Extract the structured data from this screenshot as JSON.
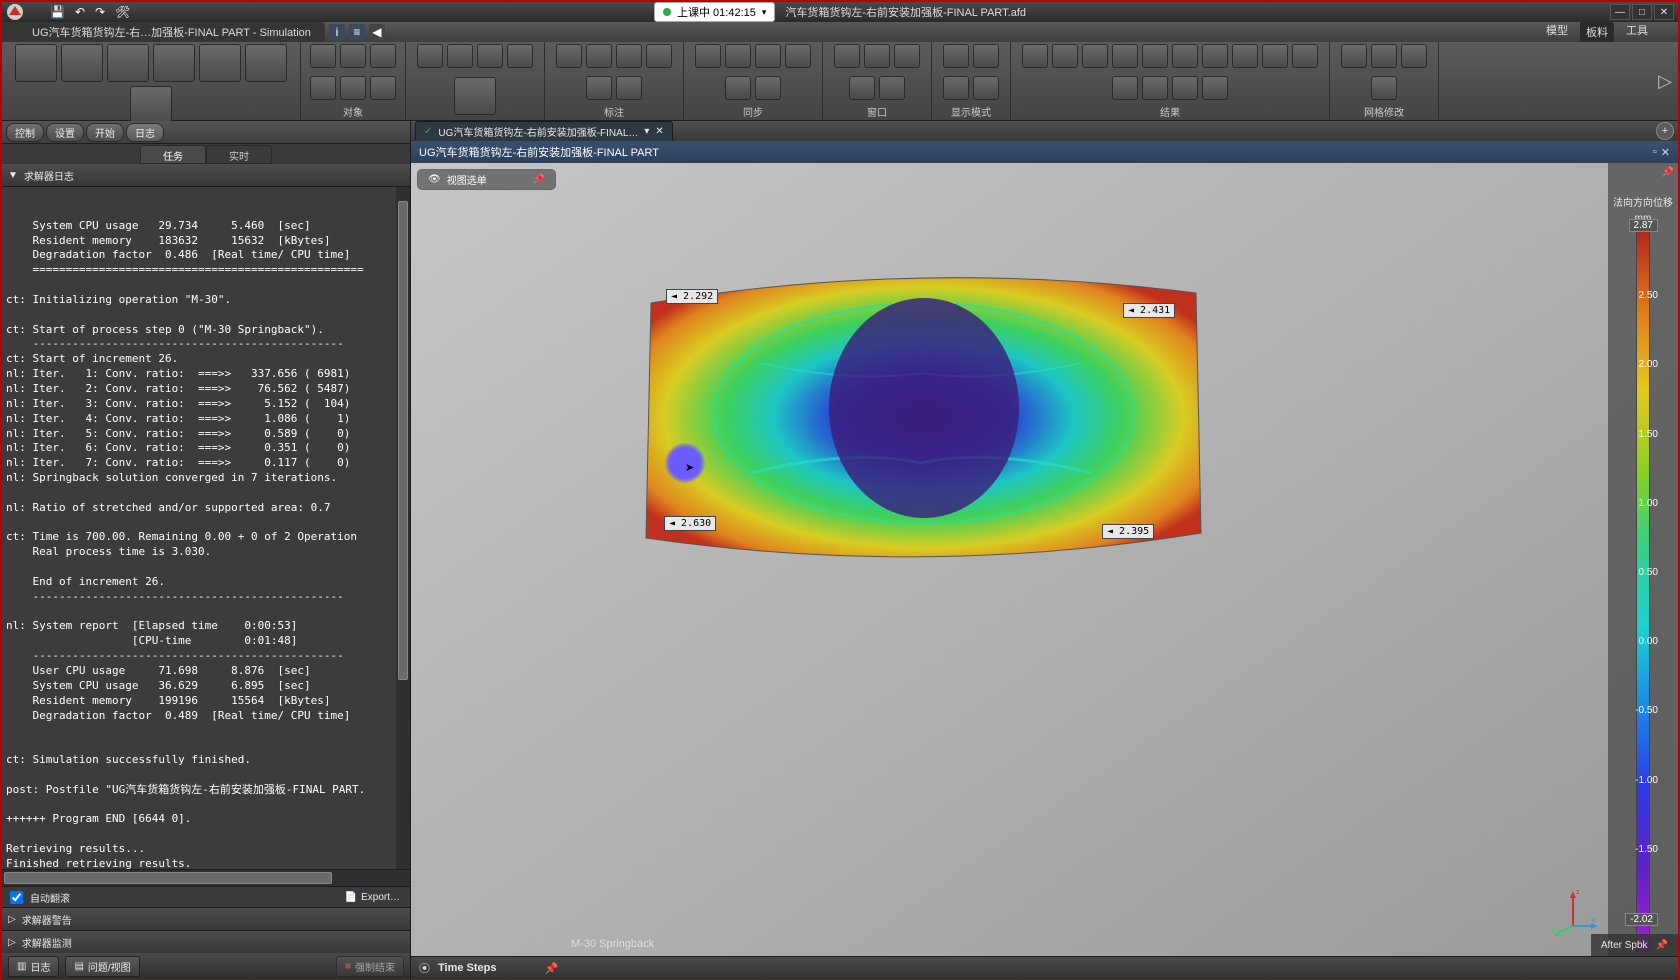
{
  "titlebar": {
    "session": "上课中 01:42:15",
    "filename": "汽车货箱货钩左-右前安装加强板-FINAL PART.afd"
  },
  "subtab": "UG汽车货箱货钩左-右…加强板-FINAL PART - Simulation",
  "menu_right": {
    "a": "模型",
    "b": "板料",
    "c": "工具"
  },
  "ribbon_groups": [
    "对象",
    "标注",
    "同步",
    "窗口",
    "显示模式",
    "结果",
    "网格修改"
  ],
  "leftpane": {
    "tabs": {
      "a": "控制",
      "b": "设置",
      "c": "开始",
      "d": "日志"
    },
    "subtabs": {
      "a": "任务",
      "b": "实时"
    },
    "header": "求解器日志",
    "autoscroll": "自动翻滚",
    "export": "Export…",
    "acc1": "求解器警告",
    "acc2": "求解器监测",
    "status1": "日志",
    "status2": "问题/视图",
    "force": "强制结束"
  },
  "log": "    System CPU usage   29.734     5.460  [sec]\n    Resident memory    183632     15632  [kBytes]\n    Degradation factor  0.486  [Real time/ CPU time]\n    ==================================================\n\nct: Initializing operation \"M-30\".\n\nct: Start of process step 0 (\"M-30 Springback\").\n    -----------------------------------------------\nct: Start of increment 26.\nnl: Iter.   1: Conv. ratio:  ===>>   337.656 ( 6981)\nnl: Iter.   2: Conv. ratio:  ===>>    76.562 ( 5487)\nnl: Iter.   3: Conv. ratio:  ===>>     5.152 (  104)\nnl: Iter.   4: Conv. ratio:  ===>>     1.086 (    1)\nnl: Iter.   5: Conv. ratio:  ===>>     0.589 (    0)\nnl: Iter.   6: Conv. ratio:  ===>>     0.351 (    0)\nnl: Iter.   7: Conv. ratio:  ===>>     0.117 (    0)\nnl: Springback solution converged in 7 iterations.\n\nnl: Ratio of stretched and/or supported area: 0.7\n\nct: Time is 700.00. Remaining 0.00 + 0 of 2 Operation\n    Real process time is 3.030.\n\n    End of increment 26.\n    -----------------------------------------------\n\nnl: System report  [Elapsed time    0:00:53]\n                   [CPU-time        0:01:48]\n    -----------------------------------------------\n    User CPU usage     71.698     8.876  [sec]\n    System CPU usage   36.629     6.895  [sec]\n    Resident memory    199196     15564  [kBytes]\n    Degradation factor  0.489  [Real time/ CPU time]\n\n\nct: Simulation successfully finished.\n\npost: Postfile \"UG汽车货箱货钩左-右前安装加强板-FINAL PART.\n\n++++++ Program END [6644 0].\n\nRetrieving results...\nFinished retrieving results.",
  "doctab": "UG汽车货箱货钩左-右前安装加强板-FINAL…",
  "viewhead": "UG汽车货箱货钩左-右前安装加强板-FINAL PART",
  "viewmenu": "视图选单",
  "legend": {
    "title": "法向方向位移",
    "unit": "mm",
    "vals": [
      "2.87",
      "2.50",
      "2.00",
      "1.50",
      "1.00",
      "0.50",
      "0.00",
      "-0.50",
      "-1.00",
      "-1.50",
      "-2.02"
    ]
  },
  "callouts": {
    "tl": "2.292",
    "tr": "2.431",
    "bl": "2.630",
    "br": "2.395"
  },
  "simstatus": "M-30 Springback",
  "after": "After Spbk",
  "timesteps": "Time Steps",
  "chart_data": {
    "type": "heatmap",
    "title": "法向方向位移",
    "unit": "mm",
    "range": [
      -2.02,
      2.87
    ],
    "ticks": [
      2.87,
      2.5,
      2.0,
      1.5,
      1.0,
      0.5,
      0.0,
      -0.5,
      -1.0,
      -1.5,
      -2.02
    ],
    "probe_points": [
      {
        "label": "top-left",
        "value": 2.292
      },
      {
        "label": "top-right",
        "value": 2.431
      },
      {
        "label": "bottom-left",
        "value": 2.63
      },
      {
        "label": "bottom-right",
        "value": 2.395
      }
    ]
  }
}
